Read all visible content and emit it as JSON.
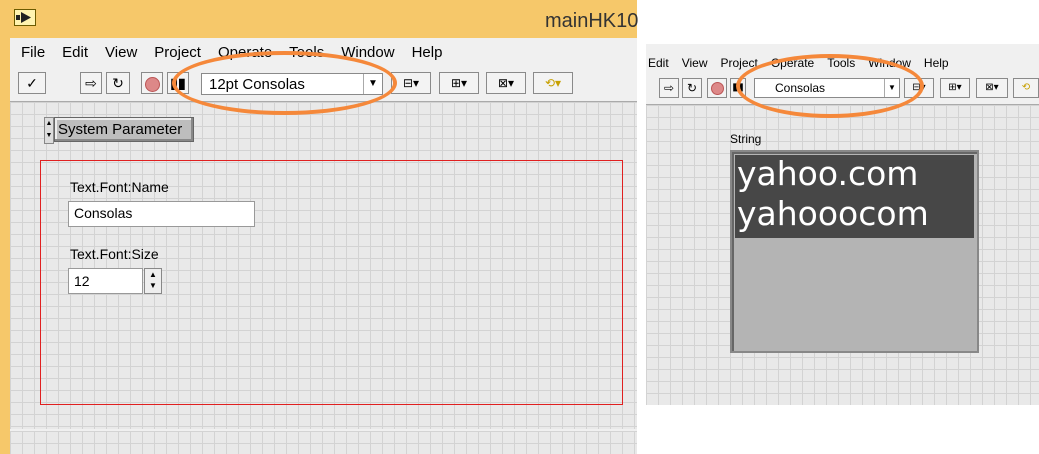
{
  "left": {
    "window_title": "mainHK10",
    "menu": [
      "File",
      "Edit",
      "View",
      "Project",
      "Operate",
      "Tools",
      "Window",
      "Help"
    ],
    "font_dropdown": "12pt Consolas",
    "system_param_label": "System Parameter",
    "font_name_label": "Text.Font:Name",
    "font_name_value": "Consolas",
    "font_size_label": "Text.Font:Size",
    "font_size_value": "12"
  },
  "right": {
    "menu": [
      "Edit",
      "View",
      "Project",
      "Operate",
      "Tools",
      "Window",
      "Help"
    ],
    "font_dropdown": "Consolas",
    "string_label": "String",
    "string_lines": [
      "yahoo.com",
      "yahooocom"
    ]
  },
  "colors": {
    "title_bar": "#f6c86a",
    "highlight_oval": "#f5883a",
    "cluster_border": "#e02020",
    "string_top": "#474747",
    "string_bottom": "#b4b4b4"
  }
}
